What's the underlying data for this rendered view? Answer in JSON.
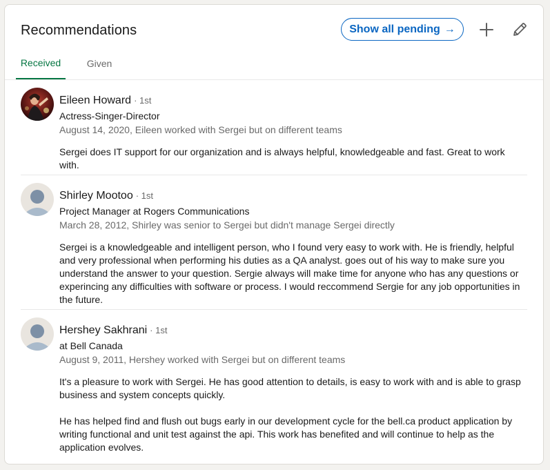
{
  "header": {
    "title": "Recommendations",
    "show_pending_label": "Show all pending",
    "show_pending_arrow": "→",
    "add_icon": "plus-icon",
    "edit_icon": "pencil-icon"
  },
  "tabs": [
    {
      "label": "Received",
      "active": true
    },
    {
      "label": "Given",
      "active": false
    }
  ],
  "colors": {
    "accent_blue": "#0a66c2",
    "active_tab_green": "#057642"
  },
  "recommendations": [
    {
      "name": "Eileen Howard",
      "degree": "· 1st",
      "headline": "Actress-Singer-Director",
      "meta": "August 14, 2020, Eileen worked with Sergei but on different teams",
      "paragraphs": [
        "Sergei does IT support for our organization and is always helpful, knowledgeable and fast. Great to work with."
      ],
      "avatar": "photo"
    },
    {
      "name": "Shirley Mootoo",
      "degree": "· 1st",
      "headline": "Project Manager at Rogers Communications",
      "meta": "March 28, 2012, Shirley was senior to Sergei but didn't manage Sergei directly",
      "paragraphs": [
        "Sergei is a knowledgeable and intelligent person, who I found very easy to work with. He is friendly, helpful and very professional when performing his duties as a QA analyst. goes out of his way to make sure you understand the answer to your question. Sergie always will make time for anyone who has any questions or experincing any difficulties with software or process. I would reccommend Sergie for any job opportunities in the future."
      ],
      "avatar": "placeholder"
    },
    {
      "name": "Hershey Sakhrani",
      "degree": "· 1st",
      "headline": "at Bell Canada",
      "meta": "August 9, 2011, Hershey worked with Sergei but on different teams",
      "paragraphs": [
        "It's a pleasure to work with Sergei. He has good attention to details, is easy to work with and is able to grasp business and system concepts quickly.",
        "He has helped find and flush out bugs early in our development cycle for the bell.ca product application by writing functional and unit test against the api. This work has benefited and will continue to help as the application evolves."
      ],
      "avatar": "placeholder"
    }
  ]
}
